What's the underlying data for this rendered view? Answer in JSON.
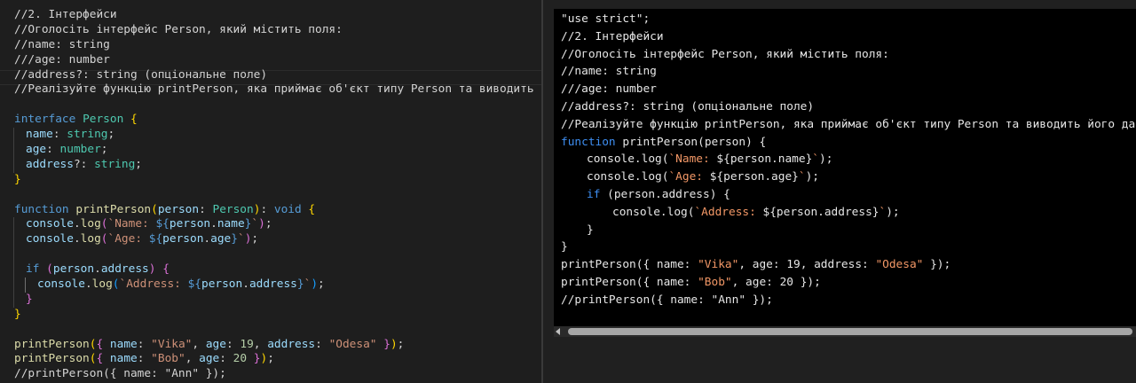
{
  "editor": {
    "comments": [
      "//2. Інтерфейси",
      "//Оголосіть інтерфейс Person, який містить поля:",
      "//name: string",
      "///age: number",
      "//address?: string (опціональне поле)",
      "//Реалізуйте функцію printPerson, яка приймає об'єкт типу Person та виводить його"
    ],
    "code": {
      "kw_interface": "interface",
      "kw_function": "function",
      "kw_if": "if",
      "iface_name": "Person",
      "fn_name": "printPerson",
      "param": "person",
      "void": "void",
      "type_string": "string",
      "type_number": "number",
      "field_name": "name",
      "field_age": "age",
      "field_address": "address",
      "console": "console",
      "log": "log",
      "str_name": "Name: ",
      "str_age": "Age: ",
      "str_address": "Address: ",
      "call1": {
        "name": "\"Vika\"",
        "age": "19",
        "address": "\"Odesa\""
      },
      "call2": {
        "name": "\"Bob\"",
        "age": "20"
      },
      "call3_comment": "//printPerson({ name: \"Ann\" });"
    }
  },
  "console_output": {
    "use_strict": "\"use strict\";",
    "comments": [
      "//2. Інтерфейси",
      "//Оголосіть інтерфейс Person, який містить поля:",
      "//name: string",
      "///age: number",
      "//address?: string (опціональне поле)",
      "//Реалізуйте функцію printPerson, яка приймає об'єкт типу Person та виводить його дані у к"
    ],
    "kw_function": "function",
    "kw_if": "if",
    "fn_name": "printPerson",
    "param": "person",
    "console_log": "console.log",
    "str_name": "`Name: ",
    "str_age": "`Age: ",
    "str_address": "`Address: ",
    "call1": {
      "name": "\"Vika\"",
      "age": "19",
      "address": "\"Odesa\""
    },
    "call2": {
      "name": "\"Bob\"",
      "age": "20"
    },
    "call3_comment": "//printPerson({ name: \"Ann\" });"
  }
}
